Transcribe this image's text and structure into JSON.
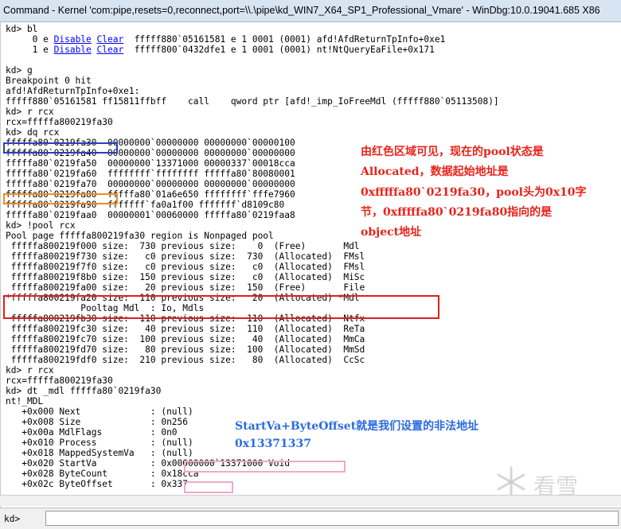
{
  "window": {
    "title": "Command - Kernel 'com:pipe,resets=0,reconnect,port=\\\\.\\pipe\\kd_WIN7_X64_SP1_Professional_Vmare' - WinDbg:10.0.19041.685 X86"
  },
  "bp_list": [
    {
      "pre": "     0 e ",
      "disable": "Disable",
      "clear": "Clear",
      "post": "  fffff880`05161581 e 1 0001 (0001) afd!AfdReturnTpInfo+0xe1"
    },
    {
      "pre": "     1 e ",
      "disable": "Disable",
      "clear": "Clear",
      "post": "  fffff800`0432dfe1 e 1 0001 (0001) nt!NtQueryEaFile+0x171"
    }
  ],
  "lines": {
    "l00": "kd> bl",
    "l03": "",
    "l04": "kd> g",
    "l05": "Breakpoint 0 hit",
    "l06": "afd!AfdReturnTpInfo+0xe1:",
    "l07": "fffff880`05161581 ff15811ffbff    call    qword ptr [afd!_imp_IoFreeMdl (fffff880`05113508)]",
    "l08": "kd> r rcx",
    "l09": "rcx=fffffa800219fa30",
    "l10": "kd> dq rcx",
    "l11": "fffffa80`0219fa30  00000000`00000000 00000000`00000100",
    "l12": "fffffa80`0219fa40  00000000`00000000 00000000`00000000",
    "l13": "fffffa80`0219fa50  00000000`13371000 00000337`00018cca",
    "l14": "fffffa80`0219fa60  ffffffff`ffffffff fffffa80`80080001",
    "l15": "fffffa80`0219fa70  00000000`00000000 00000000`00000000",
    "l16": "fffffa80`0219fa80  fffffa80`01a6e650 ffffffff`fffe7960",
    "l17": "fffffa80`0219fa90  fffffff`fa0a1f00 fffffff`d8109c80",
    "l18": "fffffa80`0219faa0  00000001`00060000 fffffa80`0219faa8",
    "l19": "kd> !pool rcx",
    "l20": "Pool page fffffa800219fa30 region is Nonpaged pool",
    "l21": " fffffa800219f000 size:  730 previous size:    0  (Free)       Mdl",
    "l22": " fffffa800219f730 size:   c0 previous size:  730  (Allocated)  FMsl",
    "l23": " fffffa800219f7f0 size:   c0 previous size:   c0  (Allocated)  FMsl",
    "l24": " fffffa800219f8b0 size:  150 previous size:   c0  (Allocated)  MiSc",
    "l25": " fffffa800219fa00 size:   20 previous size:  150  (Free)       File",
    "l26": "*fffffa800219fa20 size:  110 previous size:   20  (Allocated) *Mdl",
    "l27": "              Pooltag Mdl  : Io, Mdls",
    "l28": " fffffa800219fb30 size:  110 previous size:  110  (Allocated)  Ntfx",
    "l29": " fffffa800219fc30 size:   40 previous size:  110  (Allocated)  ReTa",
    "l30": " fffffa800219fc70 size:  100 previous size:   40  (Allocated)  MmCa",
    "l31": " fffffa800219fd70 size:   80 previous size:  100  (Allocated)  MmSd",
    "l32": " fffffa800219fdf0 size:  210 previous size:   80  (Allocated)  CcSc",
    "l33": "kd> r rcx",
    "l34": "rcx=fffffa800219fa30",
    "l35": "kd> dt _mdl fffffa80`0219fa30",
    "l36": "nt!_MDL",
    "l37": "   +0x000 Next             : (null)",
    "l38": "   +0x008 Size             : 0n256",
    "l39": "   +0x00a MdlFlags         : 0n0",
    "l40": "   +0x010 Process          : (null)",
    "l41": "   +0x018 MappedSystemVa   : (null)",
    "l42": "   +0x020 StartVa          : 0x00000000`13371000 Void",
    "l43": "   +0x028 ByteCount        : 0x18cca",
    "l44": "   +0x02c ByteOffset       : 0x337"
  },
  "annotations": {
    "pool_1": "由红色区域可见，现在的pool状态是",
    "pool_2": "Allocated，数据起始地址是",
    "pool_3": "0xfffffa80`0219fa30，pool头为0x10字",
    "pool_4": "节，0xfffffa80`0219fa80指向的是",
    "pool_5": "object地址",
    "start_1": "StartVa+ByteOffset就是我们设置的非法地址",
    "start_2": "0x13371337"
  },
  "command_bar": {
    "prompt": "kd>",
    "input_value": ""
  },
  "watermark": {
    "text": "看雪"
  },
  "colors": {
    "annotation_red": "#e8231a",
    "annotation_blue": "#2b6be0",
    "highlight_blue": "#2c3fbf",
    "highlight_orange": "#f08c20",
    "highlight_red": "#e01e1e",
    "highlight_pink": "#f2a9c9",
    "link": "#0000ff"
  }
}
